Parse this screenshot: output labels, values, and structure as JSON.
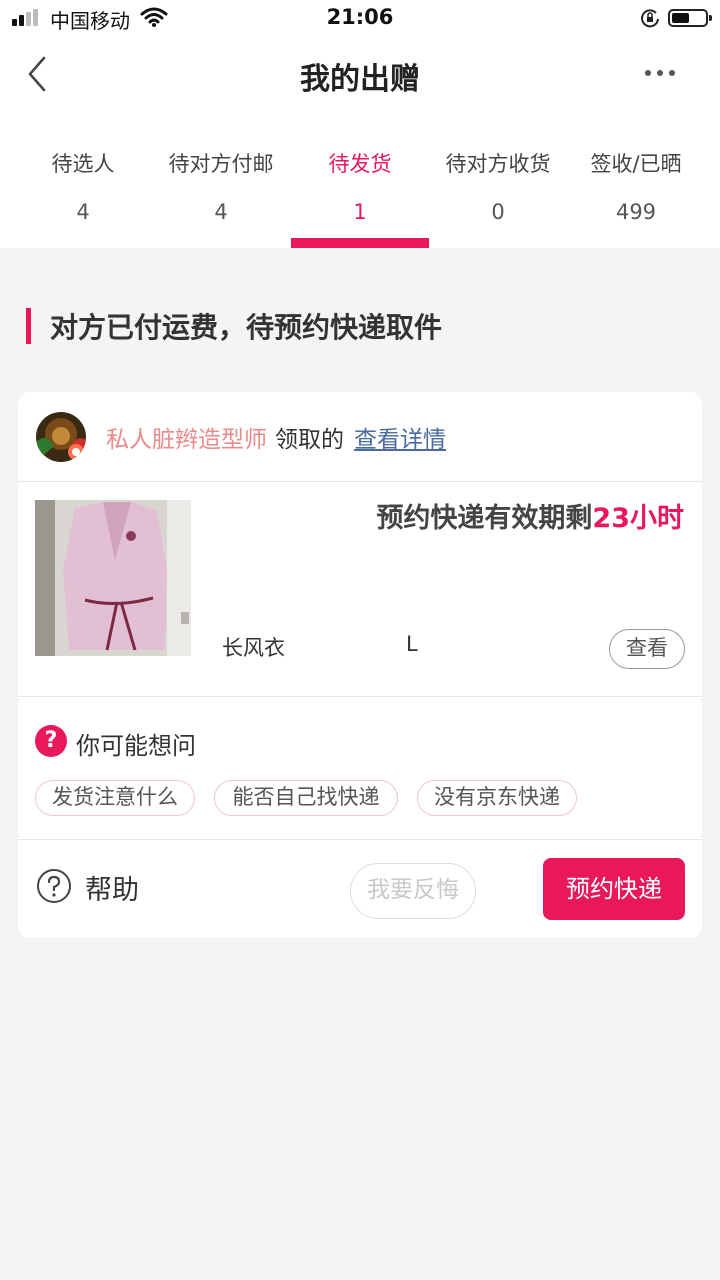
{
  "status_bar": {
    "carrier": "中国移动",
    "time": "21:06"
  },
  "nav": {
    "title": "我的出赠"
  },
  "tabs": [
    {
      "label": "待选人",
      "count": "4"
    },
    {
      "label": "待对方付邮",
      "count": "4"
    },
    {
      "label": "待发货",
      "count": "1"
    },
    {
      "label": "待对方收货",
      "count": "0"
    },
    {
      "label": "签收/已晒",
      "count": "499"
    }
  ],
  "active_tab": "待发货",
  "section": {
    "title": "对方已付运费，待预约快递取件"
  },
  "card": {
    "claimer": "私人脏辫造型师",
    "claim_text": "领取的",
    "detail_link": "查看详情",
    "deadline_prefix": "预约快递有效期剩",
    "deadline_value": "23小时",
    "product_name": "长风衣",
    "product_size": "L",
    "view_button": "查看",
    "faq_title": "你可能想问",
    "faq_chips": [
      "发货注意什么",
      "能否自己找快递",
      "没有京东快递"
    ],
    "help_label": "帮助",
    "regret_button": "我要反悔",
    "book_button": "预约快递"
  },
  "colors": {
    "accent": "#e8185a",
    "link": "#4a6aa0",
    "claimer": "#ea8a8a",
    "background": "#f4f4f4"
  }
}
